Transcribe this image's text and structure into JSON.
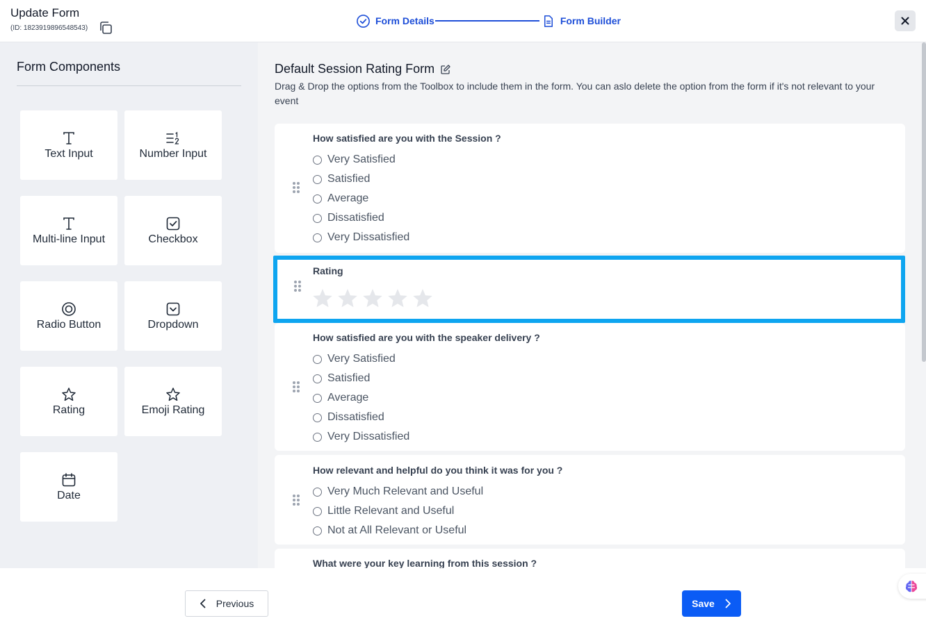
{
  "header": {
    "title": "Update Form",
    "form_id": "(ID: 1823919896548543)",
    "steps": [
      {
        "label": "Form Details",
        "icon": "check-circle-icon"
      },
      {
        "label": "Form Builder",
        "icon": "document-icon"
      }
    ],
    "accent_color": "#1d4ed8"
  },
  "sidebar": {
    "title": "Form Components",
    "components": [
      {
        "label": "Text Input",
        "icon": "text-icon"
      },
      {
        "label": "Number Input",
        "icon": "number-list-icon"
      },
      {
        "label": "Multi-line Input",
        "icon": "text-icon"
      },
      {
        "label": "Checkbox",
        "icon": "checkbox-icon"
      },
      {
        "label": "Radio Button",
        "icon": "radio-icon"
      },
      {
        "label": "Dropdown",
        "icon": "dropdown-icon"
      },
      {
        "label": "Rating",
        "icon": "star-icon"
      },
      {
        "label": "Emoji Rating",
        "icon": "star-icon"
      },
      {
        "label": "Date",
        "icon": "calendar-icon"
      }
    ]
  },
  "main": {
    "form_title": "Default Session Rating Form",
    "description": "Drag & Drop the options from the Toolbox to include them in the form. You can aslo delete the option from the form if it's not relevant to your event",
    "questions": [
      {
        "title": "How satisfied are you with the Session ?",
        "options": [
          "Very Satisfied",
          "Satisfied",
          "Average",
          "Dissatisfied",
          "Very Dissatisfied"
        ]
      },
      {
        "title": "Rating",
        "type": "rating",
        "stars": 5,
        "selected": true
      },
      {
        "title": "How satisfied are you with the speaker delivery ?",
        "options": [
          "Very Satisfied",
          "Satisfied",
          "Average",
          "Dissatisfied",
          "Very Dissatisfied"
        ]
      },
      {
        "title": "How relevant and helpful do you think it was for you ?",
        "options": [
          "Very Much Relevant and Useful",
          "Little Relevant and Useful",
          "Not at All Relevant or Useful"
        ]
      },
      {
        "title": "What were your key learning from this session ?"
      }
    ],
    "selected_border_color": "#0ea5f0"
  },
  "footer": {
    "previous_label": "Previous",
    "save_label": "Save",
    "save_color": "#0b5cf5"
  }
}
